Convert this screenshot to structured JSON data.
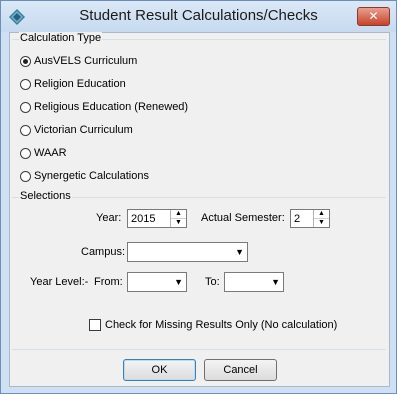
{
  "window": {
    "title": "Student Result Calculations/Checks",
    "close_label": "✕"
  },
  "calculation_type": {
    "label": "Calculation Type",
    "options": [
      {
        "label": "AusVELS Curriculum",
        "selected": true
      },
      {
        "label": "Religion Education",
        "selected": false
      },
      {
        "label": "Religious Education (Renewed)",
        "selected": false
      },
      {
        "label": "Victorian Curriculum",
        "selected": false
      },
      {
        "label": "WAAR",
        "selected": false
      },
      {
        "label": "Synergetic Calculations",
        "selected": false
      }
    ]
  },
  "selections": {
    "label": "Selections",
    "year_label": "Year:",
    "year_value": "2015",
    "semester_label": "Actual Semester:",
    "semester_value": "2",
    "campus_label": "Campus:",
    "campus_value": "",
    "year_level_label": "Year Level:-",
    "from_label": "From:",
    "from_value": "",
    "to_label": "To:",
    "to_value": ""
  },
  "missing_results_check": {
    "label": "Check for Missing Results Only (No calculation)",
    "checked": false
  },
  "buttons": {
    "ok": "OK",
    "cancel": "Cancel"
  }
}
